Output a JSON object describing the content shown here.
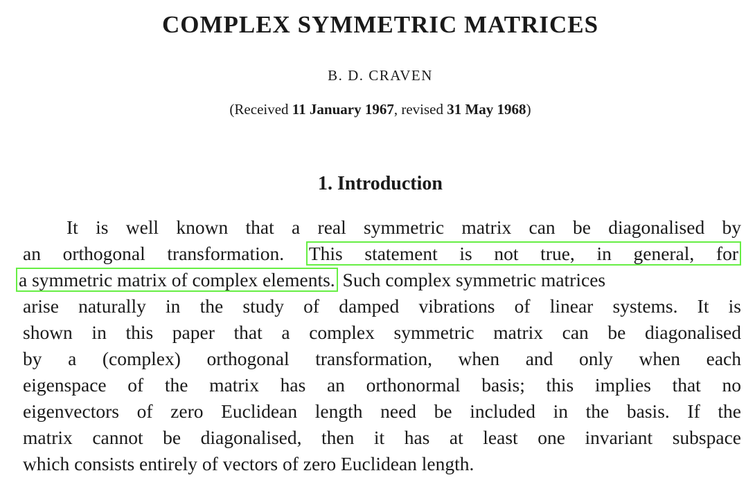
{
  "paper": {
    "title": "COMPLEX SYMMETRIC MATRICES",
    "author": "B. D. CRAVEN",
    "received": {
      "prefix": "(Received ",
      "date1": "11 January 1967",
      "mid": ", revised ",
      "date2": "31 May 1968",
      "suffix": ")"
    },
    "section_heading": "1. Introduction",
    "paragraph": {
      "l1": "It is well known that a real symmetric matrix can be diagonalised by",
      "l2_pre": "an orthogonal transformation. ",
      "l2_hl": "This statement is not true, in general, for",
      "l3_hl": "a symmetric matrix of complex elements.",
      "l3_post": " Such complex symmetric matrices",
      "l4": "arise naturally in the study of damped vibrations of linear systems. It is",
      "l5": "shown in this paper that a complex symmetric matrix can be diagonalised",
      "l6": "by a (complex) orthogonal transformation, when and only when each",
      "l7": "eigenspace of the matrix has an orthonormal basis; this implies that no",
      "l8": "eigenvectors of zero Euclidean length need be included in the basis. If the",
      "l9": "matrix cannot be diagonalised, then it has at least one invariant subspace",
      "l10": "which consists entirely of vectors of zero Euclidean length."
    },
    "highlight_color": "#66ee44"
  }
}
